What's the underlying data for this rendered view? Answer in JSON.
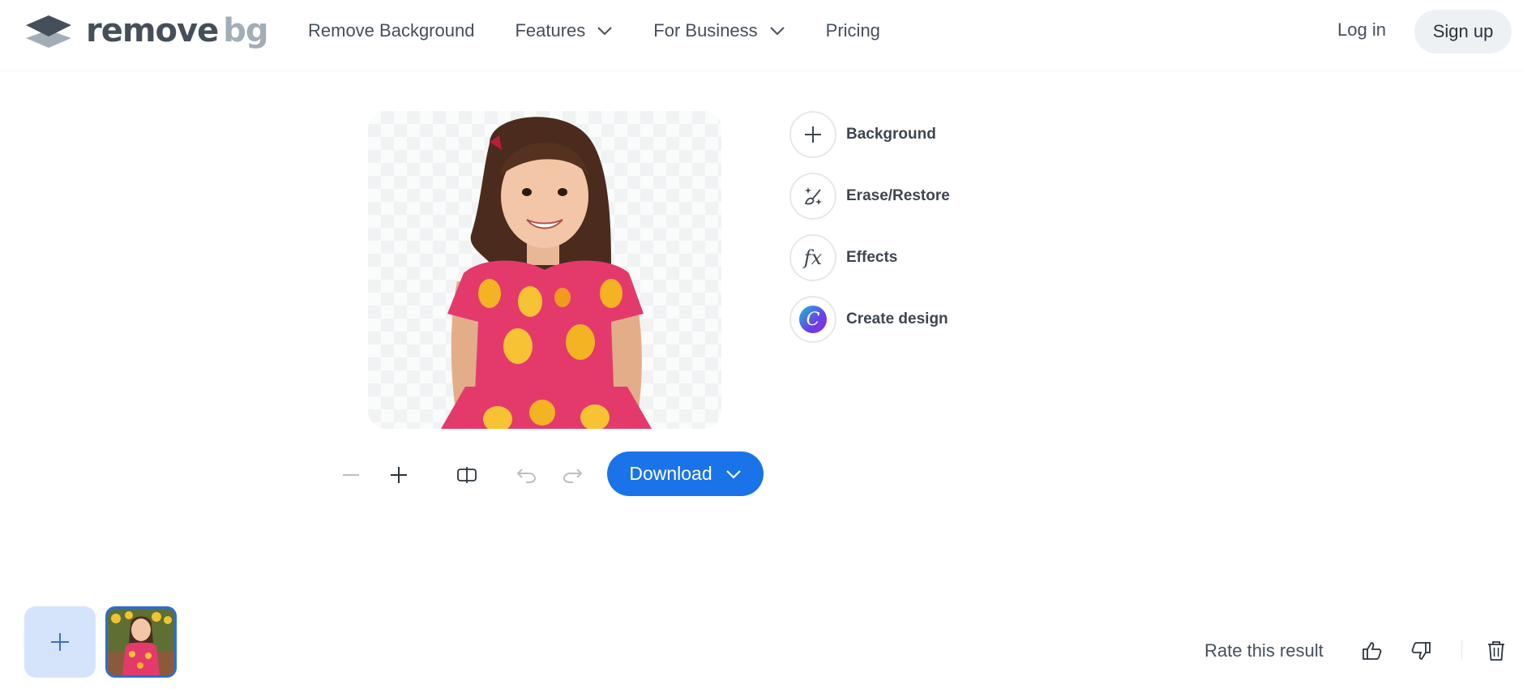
{
  "brand": {
    "name_primary": "remove",
    "name_secondary": "bg",
    "dark": "#454f5b",
    "light": "#a3adb8"
  },
  "nav": {
    "items": [
      {
        "label": "Remove Background",
        "dropdown": false
      },
      {
        "label": "Features",
        "dropdown": true
      },
      {
        "label": "For Business",
        "dropdown": true
      },
      {
        "label": "Pricing",
        "dropdown": false
      }
    ],
    "login": "Log in",
    "signup": "Sign up"
  },
  "tools": [
    {
      "label": "Background",
      "icon": "plus-icon"
    },
    {
      "label": "Erase/Restore",
      "icon": "magic-brush-icon"
    },
    {
      "label": "Effects",
      "icon": "fx-icon",
      "glyph": "fx"
    },
    {
      "label": "Create design",
      "icon": "canva-logo-icon",
      "glyph": "C"
    }
  ],
  "toolbar": {
    "zoom_out": "minus-icon",
    "zoom_in": "plus-icon",
    "compare": "compare-icon",
    "undo": "undo-icon",
    "redo": "redo-icon",
    "download_label": "Download"
  },
  "feedback": {
    "label": "Rate this result"
  },
  "colors": {
    "accent": "#1a73e8",
    "add_tile": "#d5e4fb",
    "selected_border": "#2d6bd8"
  }
}
